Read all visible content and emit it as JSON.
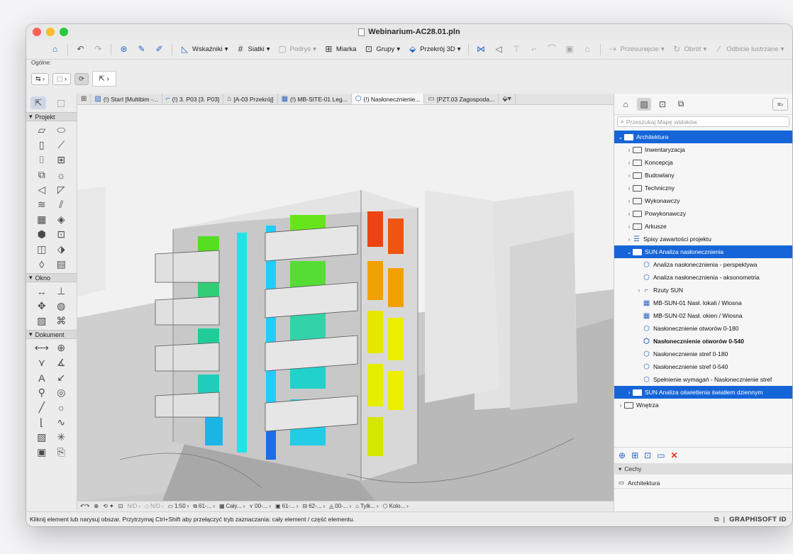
{
  "window": {
    "title": "Webinarium-AC28.01.pln"
  },
  "toolbar": {
    "items": [
      {
        "icon": "home-icon",
        "label": ""
      },
      {
        "icon": "undo-icon",
        "label": ""
      },
      {
        "icon": "redo-icon",
        "label": ""
      },
      {
        "icon": "info-pick-icon",
        "label": ""
      },
      {
        "icon": "eyedropper-icon",
        "label": ""
      },
      {
        "icon": "syringe-icon",
        "label": ""
      },
      {
        "icon": "guides-icon",
        "label": "Wskaźniki"
      },
      {
        "icon": "grid-icon",
        "label": "Siatki"
      },
      {
        "icon": "floor-icon",
        "label": "Podrys"
      },
      {
        "icon": "ruler-icon",
        "label": "Miarka"
      },
      {
        "icon": "groups-icon",
        "label": "Grupy"
      },
      {
        "icon": "section-3d-icon",
        "label": "Przekrój 3D"
      },
      {
        "icon": "split-icon",
        "label": ""
      },
      {
        "icon": "adjust-icon",
        "label": ""
      },
      {
        "icon": "trim-icon",
        "label": ""
      },
      {
        "icon": "intersect-icon",
        "label": ""
      },
      {
        "icon": "fillet-icon",
        "label": ""
      },
      {
        "icon": "offset-icon",
        "label": ""
      },
      {
        "icon": "roof-trim-icon",
        "label": ""
      },
      {
        "icon": "move-icon",
        "label": "Przesunięcie"
      },
      {
        "icon": "rotate-icon",
        "label": "Obrót"
      },
      {
        "icon": "mirror-icon",
        "label": "Odbicie lustrzane"
      }
    ]
  },
  "subbar": {
    "label": "Ogólne:"
  },
  "toolbox": {
    "sections": [
      "Projekt",
      "Okno",
      "Dokument"
    ]
  },
  "tabs": [
    {
      "label": "(!) Start [Multibim -..."
    },
    {
      "label": "(!) 3. P03 [3. P03]"
    },
    {
      "label": "[A-03 Przekrój]"
    },
    {
      "label": "(!) MB-SITE-01 Leg..."
    },
    {
      "label": "(!) Nasłonecznienie...",
      "active": true
    },
    {
      "label": "[PZT.03 Zagospoda..."
    }
  ],
  "navbar": {
    "scale": "1:50",
    "items": [
      "N/D",
      "N/D",
      "61-...",
      "Cały...",
      "00-...",
      "61-...",
      "62-...",
      "00-...",
      "Tylk...",
      "Kolo..."
    ]
  },
  "status": {
    "message": "Kliknij element lub narysuj obszar. Przytrzymaj Ctrl+Shift aby przełączyć tryb zaznaczania: cały element / część elementu.",
    "brand": "GRAPHISOFT ID"
  },
  "navigator": {
    "search_placeholder": "Przeszukaj Mapę widoków",
    "tree": [
      {
        "label": "Architektura",
        "level": 0,
        "type": "folder",
        "open": true,
        "selected": true
      },
      {
        "label": "Inwentaryzacja",
        "level": 1,
        "type": "folder"
      },
      {
        "label": "Koncepcja",
        "level": 1,
        "type": "folder"
      },
      {
        "label": "Budowlany",
        "level": 1,
        "type": "folder"
      },
      {
        "label": "Techniczny",
        "level": 1,
        "type": "folder"
      },
      {
        "label": "Wykonawczy",
        "level": 1,
        "type": "folder"
      },
      {
        "label": "Powykonawczy",
        "level": 1,
        "type": "folder"
      },
      {
        "label": "Arkusze",
        "level": 1,
        "type": "folder"
      },
      {
        "label": "Spisy zawartości projektu",
        "level": 1,
        "type": "list"
      },
      {
        "label": "SUN Analiza nasłonecznienia",
        "level": 1,
        "type": "folder",
        "open": true,
        "selected": true
      },
      {
        "label": "Analiza nasłonecznienia - perspektywa",
        "level": 2,
        "type": "view3d"
      },
      {
        "label": "Analiza nasłonecznienia - aksonometria",
        "level": 2,
        "type": "view3d"
      },
      {
        "label": "Rzuty SUN",
        "level": 2,
        "type": "plans"
      },
      {
        "label": "MB-SUN-01 Nasł. lokali / Wiosna",
        "level": 2,
        "type": "schedule"
      },
      {
        "label": "MB-SUN-02 Nasł. okien / Wiosna",
        "level": 2,
        "type": "schedule"
      },
      {
        "label": "Nasłonecznienie otworów 0-180",
        "level": 2,
        "type": "view3d"
      },
      {
        "label": "Nasłonecznienie otworów 0-540",
        "level": 2,
        "type": "view3d",
        "bold": true
      },
      {
        "label": "Nasłonecznienie stref 0-180",
        "level": 2,
        "type": "view3d"
      },
      {
        "label": "Nasłonecznienie stref 0-540",
        "level": 2,
        "type": "view3d"
      },
      {
        "label": "Spełnienie wymagań - Nasłonecznienie stref",
        "level": 2,
        "type": "view3d"
      },
      {
        "label": "SUN Analiza oświetlenia światłem dziennym",
        "level": 1,
        "type": "folder",
        "selected": true
      },
      {
        "label": "Wnętrza",
        "level": 0,
        "type": "folder"
      }
    ],
    "properties_header": "Cechy",
    "properties_value": "Architektura"
  },
  "colors": {
    "selection": "#1565d8",
    "close": "#ff5f57",
    "minimize": "#febc2e",
    "maximize": "#28c840"
  }
}
